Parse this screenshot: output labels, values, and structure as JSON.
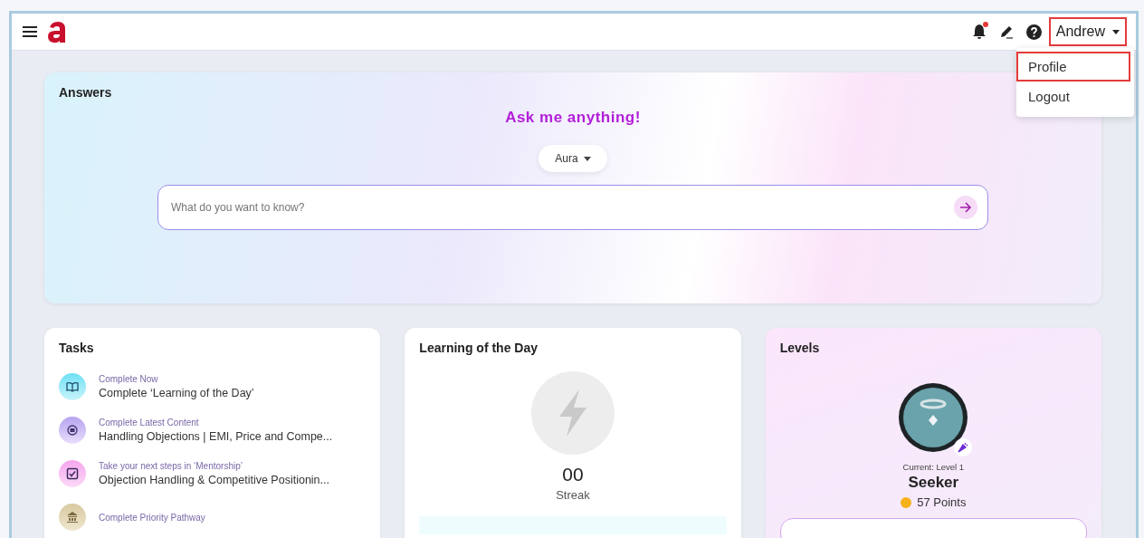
{
  "header": {
    "user_name": "Andrew",
    "user_highlighted": true,
    "notification_unread": true
  },
  "user_menu": {
    "expanded": true,
    "items": [
      {
        "label": "Profile",
        "highlighted": true
      },
      {
        "label": "Logout",
        "highlighted": false
      }
    ]
  },
  "answers": {
    "title": "Answers",
    "headline": "Ask me anything!",
    "model": "Aura",
    "search": {
      "placeholder": "What do you want to know?"
    }
  },
  "tasks": {
    "title": "Tasks",
    "items": [
      {
        "kind": "book",
        "caption": "Complete Now",
        "text": "Complete ‘Learning of the Day’"
      },
      {
        "kind": "content",
        "caption": "Complete Latest Content",
        "text": "Handling Objections | EMI, Price and Compe..."
      },
      {
        "kind": "check",
        "caption": "Take your next steps in ‘Mentorship’",
        "text": "Objection Handling & Competitive Positionin..."
      },
      {
        "kind": "pathway",
        "caption": "Complete Priority Pathway"
      }
    ]
  },
  "learning": {
    "title": "Learning of the Day",
    "streak_count": "00",
    "streak_label": "Streak"
  },
  "levels": {
    "title": "Levels",
    "current": "Current: Level 1",
    "name": "Seeker",
    "points": "57 Points"
  }
}
